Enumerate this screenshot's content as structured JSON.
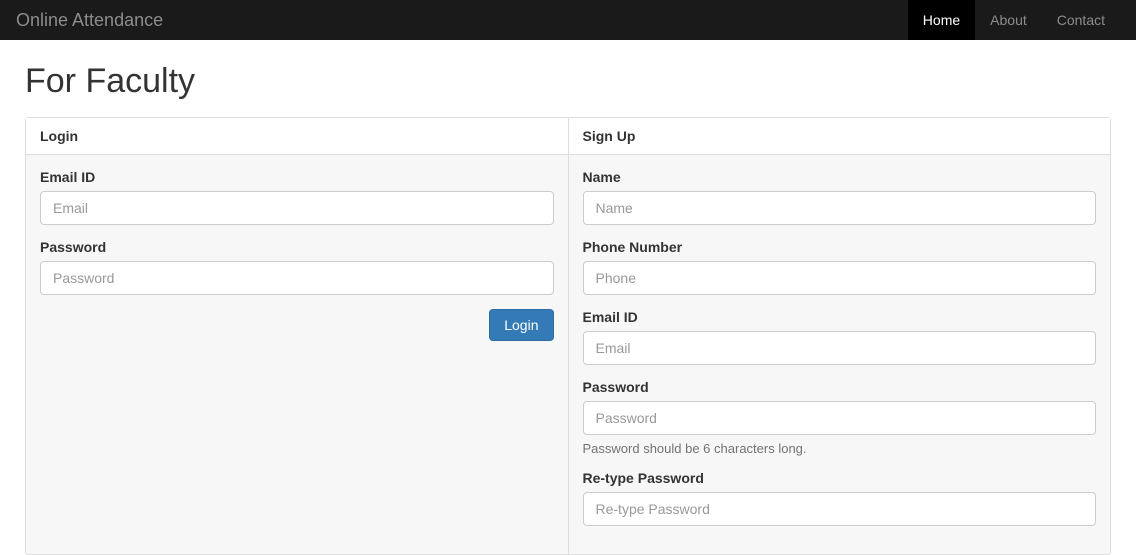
{
  "navbar": {
    "brand": "Online Attendance",
    "items": [
      {
        "label": "Home",
        "active": true
      },
      {
        "label": "About",
        "active": false
      },
      {
        "label": "Contact",
        "active": false
      }
    ]
  },
  "page": {
    "title": "For Faculty"
  },
  "login": {
    "header": "Login",
    "email_label": "Email ID",
    "email_placeholder": "Email",
    "password_label": "Password",
    "password_placeholder": "Password",
    "button_label": "Login"
  },
  "signup": {
    "header": "Sign Up",
    "name_label": "Name",
    "name_placeholder": "Name",
    "phone_label": "Phone Number",
    "phone_placeholder": "Phone",
    "email_label": "Email ID",
    "email_placeholder": "Email",
    "password_label": "Password",
    "password_placeholder": "Password",
    "password_help": "Password should be 6 characters long.",
    "retype_label": "Re-type Password",
    "retype_placeholder": "Re-type Password"
  }
}
